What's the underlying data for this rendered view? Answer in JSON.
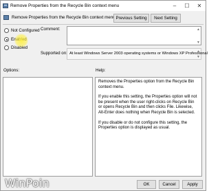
{
  "window": {
    "title": "Remove Properties from the Recycle Bin context menu"
  },
  "header": {
    "setting_title": "Remove Properties from the Recycle Bin context menu",
    "previous_label": "Previous Setting",
    "next_label": "Next Setting"
  },
  "state": {
    "options": [
      {
        "label": "Not Configured",
        "selected": false
      },
      {
        "label": "Enabled",
        "selected": true
      },
      {
        "label": "Disabled",
        "selected": false
      }
    ]
  },
  "comment": {
    "label": "Comment:",
    "value": ""
  },
  "supported": {
    "label": "Supported on:",
    "value": "At least Windows Server 2003 operating systems or Windows XP Professional"
  },
  "options_panel": {
    "label": "Options:"
  },
  "help_panel": {
    "label": "Help:",
    "paragraphs": [
      "Removes the Properties option from the Recycle Bin context menu.",
      "If you enable this setting, the Properties option will not be present when the user right-clicks on Recycle Bin or opens Recycle Bin and then clicks File. Likewise, Alt-Enter does nothing when Recycle Bin is selected.",
      "If you disable or do not configure this setting, the Properties option is displayed as usual."
    ]
  },
  "footer": {
    "ok_label": "OK",
    "cancel_label": "Cancel",
    "apply_label": "Apply"
  },
  "watermark": {
    "text": "WinPoin"
  }
}
